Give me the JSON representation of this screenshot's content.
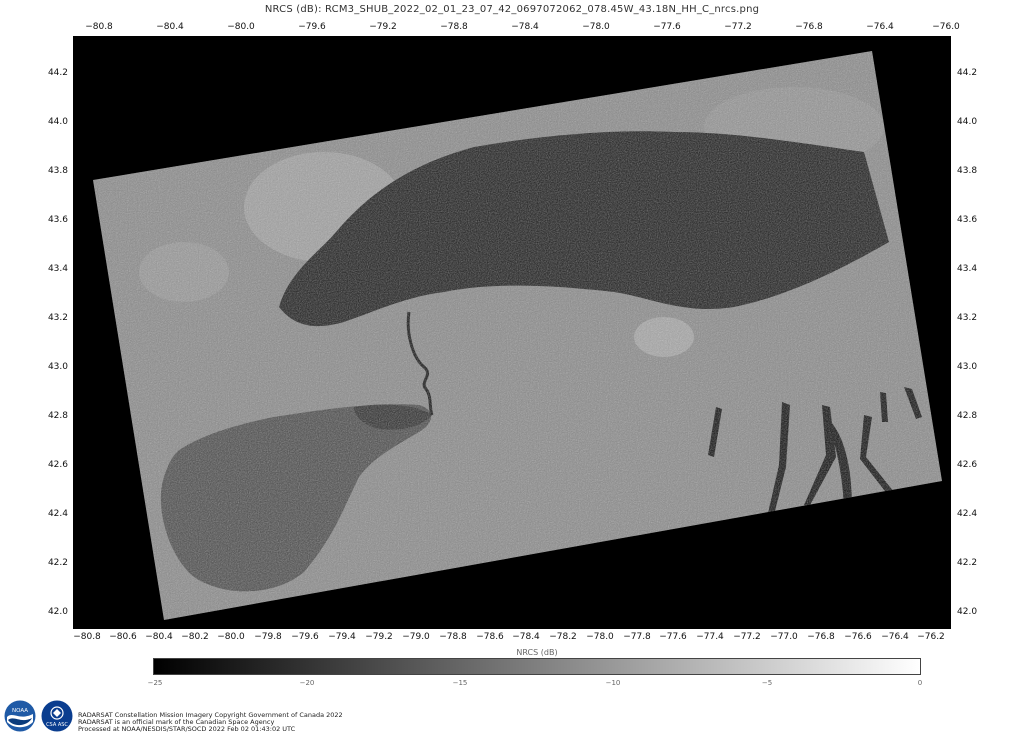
{
  "title": "NRCS (dB): RCM3_SHUB_2022_02_01_23_07_42_0697072062_078.45W_43.18N_HH_C_nrcs.png",
  "top_lon_ticks": [
    "−80.8",
    "−80.4",
    "−80.0",
    "−79.6",
    "−79.2",
    "−78.8",
    "−78.4",
    "−78.0",
    "−77.6",
    "−77.2",
    "−76.8",
    "−76.4",
    "−76.0"
  ],
  "bottom_lon_ticks": [
    "−80.8",
    "−80.6",
    "−80.4",
    "−80.2",
    "−80.0",
    "−79.8",
    "−79.6",
    "−79.4",
    "−79.2",
    "−79.0",
    "−78.8",
    "−78.6",
    "−78.4",
    "−78.2",
    "−78.0",
    "−77.8",
    "−77.6",
    "−77.4",
    "−77.2",
    "−77.0",
    "−76.8",
    "−76.6",
    "−76.4",
    "−76.2"
  ],
  "lat_ticks": [
    "44.2",
    "44.0",
    "43.8",
    "43.6",
    "43.4",
    "43.2",
    "43.0",
    "42.8",
    "42.6",
    "42.4",
    "42.2",
    "42.0"
  ],
  "colorbar": {
    "label": "NRCS (dB)",
    "ticks": [
      "−25",
      "−20",
      "−15",
      "−10",
      "−5",
      "0"
    ],
    "low_color": "#000000",
    "high_color": "#ffffff"
  },
  "logos": {
    "left": "NOAA",
    "right": "CSA ASC"
  },
  "credits": [
    "RADARSAT Constellation Mission Imagery Copyright Government of Canada 2022",
    "RADARSAT is an official mark of the Canadian Space Agency",
    "Processed at NOAA/NESDIS/STAR/SOCD 2022 Feb 02 01:43:02 UTC"
  ]
}
